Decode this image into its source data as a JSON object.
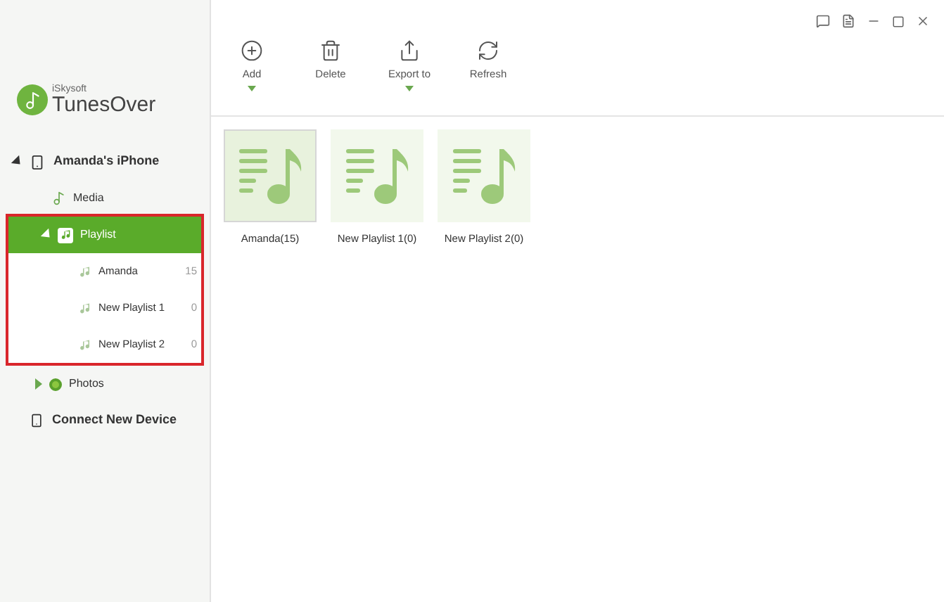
{
  "brand": {
    "vendor": "iSkysoft",
    "name": "TunesOver"
  },
  "sidebar": {
    "device": {
      "label": "Amanda's iPhone",
      "expanded": true,
      "children": [
        {
          "kind": "media",
          "label": "Media",
          "selected": false
        },
        {
          "kind": "playlist",
          "label": "Playlist",
          "selected": true,
          "expanded": true,
          "highlighted": true,
          "children": [
            {
              "label": "Amanda",
              "count": "15",
              "selected": false
            },
            {
              "label": "New Playlist 1",
              "count": "0",
              "selected": false
            },
            {
              "label": "New Playlist 2",
              "count": "0",
              "selected": false
            }
          ]
        },
        {
          "kind": "photos",
          "label": "Photos",
          "selected": false,
          "expanded": false
        }
      ]
    },
    "connect": "Connect New Device"
  },
  "toolbar": [
    {
      "kind": "add",
      "label": "Add",
      "dropdown": true
    },
    {
      "kind": "delete",
      "label": "Delete",
      "dropdown": false
    },
    {
      "kind": "export",
      "label": "Export to",
      "dropdown": true
    },
    {
      "kind": "refresh",
      "label": "Refresh",
      "dropdown": false
    }
  ],
  "playlists": [
    {
      "label": "Amanda(15)",
      "selected": true
    },
    {
      "label": "New Playlist 1(0)",
      "selected": false
    },
    {
      "label": "New Playlist 2(0)",
      "selected": false
    }
  ]
}
